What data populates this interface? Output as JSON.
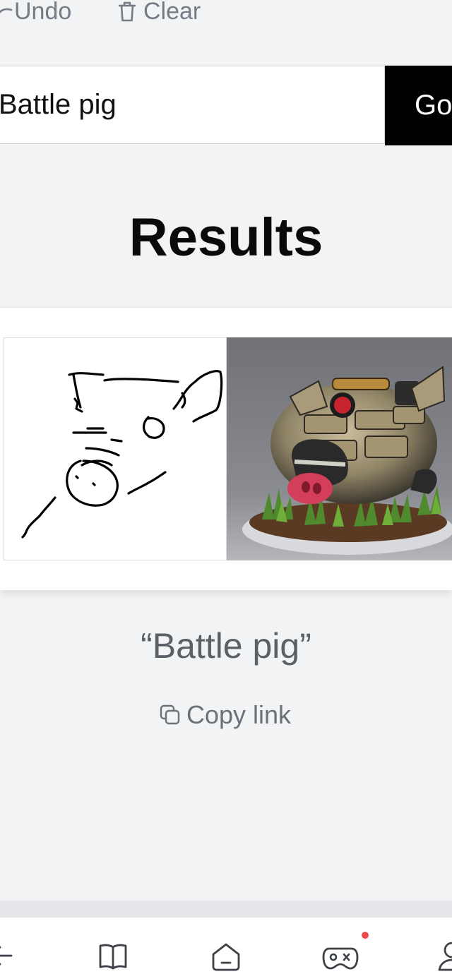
{
  "toolbar": {
    "undo_label": "Undo",
    "clear_label": "Clear"
  },
  "search": {
    "value": "Battle pig",
    "placeholder": "",
    "go_label": "Go"
  },
  "results": {
    "title": "Results",
    "prompt": "Battle pig",
    "quote_open": "“",
    "quote_close": "”",
    "copy_link_label": "Copy link"
  },
  "bottom_nav": {
    "items": [
      {
        "icon": "back-arrow-icon"
      },
      {
        "icon": "book-icon"
      },
      {
        "icon": "home-icon"
      },
      {
        "icon": "gamepad-icon",
        "notification": true
      },
      {
        "icon": "profile-icon"
      }
    ]
  },
  "colors": {
    "background": "#f2f3f5",
    "go_button_bg": "#000000",
    "caption_text": "#5b5f66",
    "notification_dot": "#ea4a50"
  }
}
